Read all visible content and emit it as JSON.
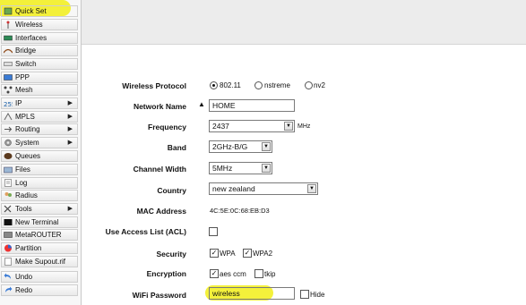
{
  "sidebar": {
    "items": [
      {
        "label": "Quick Set",
        "icon": "quick-set-icon",
        "active": true
      },
      {
        "label": "Wireless",
        "icon": "antenna-icon"
      },
      {
        "label": "Interfaces",
        "icon": "interfaces-icon"
      },
      {
        "label": "Bridge",
        "icon": "bridge-icon"
      },
      {
        "label": "Switch",
        "icon": "switch-icon"
      },
      {
        "label": "PPP",
        "icon": "ppp-icon"
      },
      {
        "label": "Mesh",
        "icon": "mesh-icon"
      },
      {
        "label": "IP",
        "icon": "ip-icon",
        "submenu": true
      },
      {
        "label": "MPLS",
        "icon": "mpls-icon",
        "submenu": true
      },
      {
        "label": "Routing",
        "icon": "routing-icon",
        "submenu": true
      },
      {
        "label": "System",
        "icon": "gear-icon",
        "submenu": true
      },
      {
        "label": "Queues",
        "icon": "queues-icon"
      },
      {
        "label": "Files",
        "icon": "folder-icon"
      },
      {
        "label": "Log",
        "icon": "log-icon"
      },
      {
        "label": "Radius",
        "icon": "radius-icon"
      },
      {
        "label": "Tools",
        "icon": "tools-icon",
        "submenu": true
      },
      {
        "label": "New Terminal",
        "icon": "terminal-icon"
      },
      {
        "label": "MetaROUTER",
        "icon": "metarouter-icon"
      },
      {
        "label": "Partition",
        "icon": "partition-icon"
      },
      {
        "label": "Make Supout.rif",
        "icon": "document-icon"
      },
      {
        "label": "Undo",
        "icon": "undo-icon"
      },
      {
        "label": "Redo",
        "icon": "redo-icon"
      }
    ]
  },
  "form": {
    "wireless_protocol": {
      "label": "Wireless Protocol",
      "options": [
        "802.11",
        "nstreme",
        "nv2"
      ],
      "selected": "802.11"
    },
    "network_name": {
      "label": "Network Name",
      "value": "HOME"
    },
    "frequency": {
      "label": "Frequency",
      "value": "2437",
      "unit": "MHz"
    },
    "band": {
      "label": "Band",
      "value": "2GHz-B/G"
    },
    "channel_width": {
      "label": "Channel Width",
      "value": "5MHz"
    },
    "country": {
      "label": "Country",
      "value": "new zealand"
    },
    "mac_address": {
      "label": "MAC Address",
      "value": "4C:5E:0C:68:EB:D3"
    },
    "use_acl": {
      "label": "Use Access List (ACL)",
      "checked": false
    },
    "security": {
      "label": "Security",
      "options": [
        {
          "label": "WPA",
          "checked": true
        },
        {
          "label": "WPA2",
          "checked": true
        }
      ]
    },
    "encryption": {
      "label": "Encryption",
      "options": [
        {
          "label": "aes ccm",
          "checked": true
        },
        {
          "label": "tkip",
          "checked": false
        }
      ]
    },
    "wifi_password": {
      "label": "WiFi Password",
      "value": "wireless",
      "hide_label": "Hide",
      "hide_checked": false
    }
  },
  "colors": {
    "highlight": "#f2ee19",
    "sidebar_bg": "#f7f7f7",
    "topbar_bg": "#ececec"
  }
}
